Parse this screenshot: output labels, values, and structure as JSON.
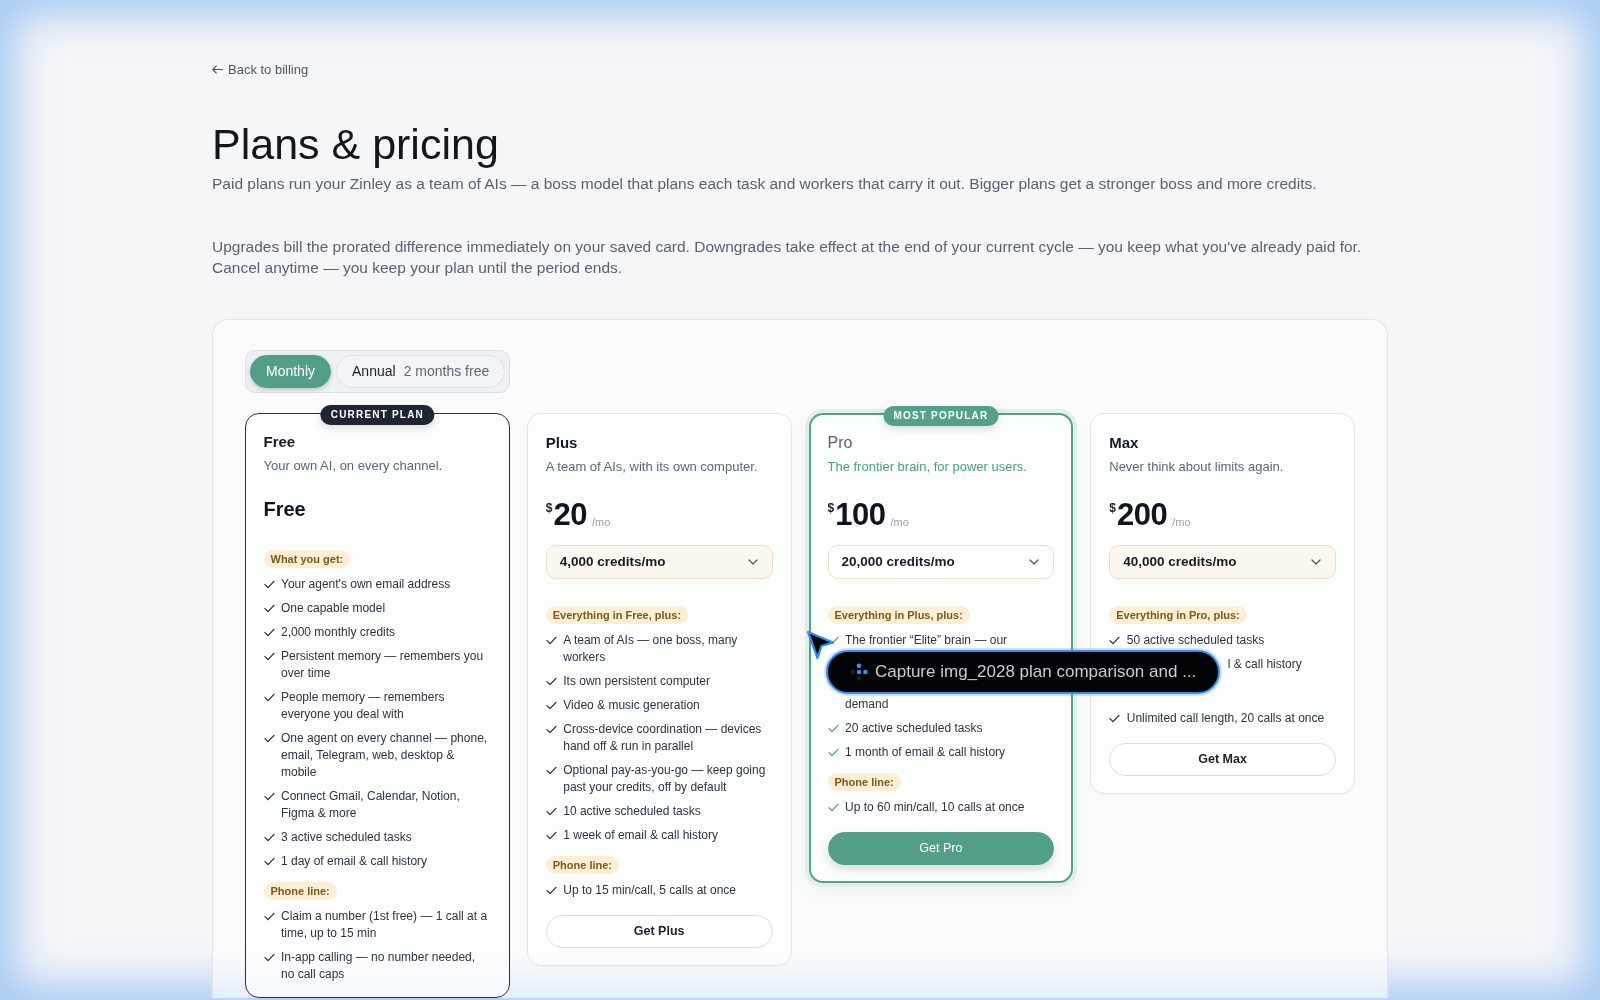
{
  "back_link": {
    "label": "Back to billing"
  },
  "title": "Plans & pricing",
  "subtitle": "Paid plans run your Zinley as a team of AIs — a boss model that plans each task and workers that carry it out. Bigger plans get a stronger boss and more credits.",
  "notice": "Upgrades bill the prorated difference immediately on your saved card. Downgrades take effect at the end of your current cycle — you keep what you've already paid for. Cancel anytime — you keep your plan until the period ends.",
  "billing_toggle": [
    {
      "label": "Monthly",
      "selected": true
    },
    {
      "label": "Annual",
      "note": "2 months free",
      "selected": false
    }
  ],
  "plans": [
    {
      "name": "Free",
      "kind": "current",
      "badge": "CURRENT PLAN",
      "tagline": "Your own AI, on every channel.",
      "price": {
        "label": "Free"
      },
      "sections": [
        {
          "label": "What you get:",
          "features": [
            {
              "text": "Your agent's own email address",
              "kind": "check"
            },
            {
              "text": "One capable model",
              "kind": "check"
            },
            {
              "text": "2,000 monthly credits",
              "kind": "check"
            },
            {
              "text": "Persistent memory — remembers you over time",
              "kind": "check"
            },
            {
              "text": "People memory — remembers everyone you deal with",
              "kind": "check"
            },
            {
              "text": "One agent on every channel — phone, email, Telegram, web, desktop & mobile",
              "kind": "check"
            },
            {
              "text": "Connect Gmail, Calendar, Notion, Figma & more",
              "kind": "check"
            },
            {
              "text": "3 active scheduled tasks",
              "kind": "check"
            },
            {
              "text": "1 day of email & call history",
              "kind": "check"
            }
          ]
        },
        {
          "label": "Phone line:",
          "features": [
            {
              "text": "Claim a number (1st free) — 1 call at a time, up to 15 min",
              "kind": "check"
            },
            {
              "text": "In-app calling — no number needed, no call caps",
              "kind": "check"
            }
          ]
        }
      ]
    },
    {
      "name": "Plus",
      "kind": "standard",
      "tagline": "A team of AIs, with its own computer.",
      "price": {
        "currency": "$",
        "amount": "20",
        "period": "/mo"
      },
      "credits": "4,000 credits/mo",
      "sections": [
        {
          "label": "Everything in Free, plus:",
          "features": [
            {
              "text": "A team of AIs — one boss, many workers",
              "kind": "check"
            },
            {
              "text": "Its own persistent computer",
              "kind": "check"
            },
            {
              "text": "Video & music generation",
              "kind": "check"
            },
            {
              "text": "Cross-device coordination — devices hand off & run in parallel",
              "kind": "check"
            },
            {
              "text": "Optional pay-as-you-go — keep going past your credits, off by default",
              "kind": "check"
            },
            {
              "text": "10 active scheduled tasks",
              "kind": "check"
            },
            {
              "text": "1 week of email & call history",
              "kind": "check"
            }
          ]
        },
        {
          "label": "Phone line:",
          "features": [
            {
              "text": "Up to 15 min/call, 5 calls at once",
              "kind": "check"
            }
          ]
        }
      ],
      "button": "Get Plus"
    },
    {
      "name": "Pro",
      "kind": "featured",
      "badge": "MOST POPULAR",
      "tagline": "The frontier brain, for power users.",
      "price": {
        "currency": "$",
        "amount": "100",
        "period": "/mo"
      },
      "credits": "20,000 credits/mo",
      "sections": [
        {
          "label": "Everything in Plus, plus:",
          "features": [
            {
              "text": "The frontier “Elite” brain — our",
              "kind": "cut_end"
            },
            {
              "text": "demand",
              "kind": "cut_start"
            },
            {
              "text": "20 active scheduled tasks",
              "kind": "check"
            },
            {
              "text": "1 month of email & call history",
              "kind": "check"
            }
          ]
        },
        {
          "label": "Phone line:",
          "features": [
            {
              "text": "Up to 60 min/call, 10 calls at once",
              "kind": "check"
            }
          ]
        }
      ],
      "button": "Get Pro"
    },
    {
      "name": "Max",
      "kind": "standard",
      "tagline": "Never think about limits again.",
      "price": {
        "currency": "$",
        "amount": "200",
        "period": "/mo"
      },
      "credits": "40,000 credits/mo",
      "sections": [
        {
          "label": "Everything in Pro, plus:",
          "features": [
            {
              "text": "50 active scheduled tasks",
              "kind": "check"
            },
            {
              "text": "l & call history",
              "kind": "cut_inline"
            }
          ]
        },
        {
          "features": [
            {
              "text": "Unlimited call length, 20 calls at once",
              "kind": "check"
            }
          ]
        }
      ],
      "button": "Get Max"
    }
  ],
  "capture_toast": {
    "text": "Capture img_2028 plan comparison and ..."
  }
}
